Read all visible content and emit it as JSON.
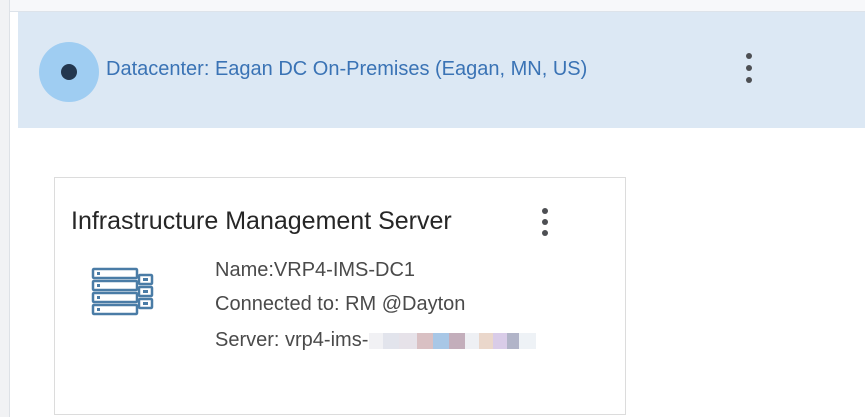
{
  "datacenter": {
    "title": "Datacenter: Eagan DC On-Premises (Eagan, MN, US)",
    "status_icon": "status-dot-icon",
    "menu_icon": "kebab-menu-icon",
    "colors": {
      "header_bg": "#dce8f4",
      "status_ring": "#9fcdf2",
      "status_dot": "#23374f",
      "title_text": "#3a73b5"
    }
  },
  "server_card": {
    "title": "Infrastructure Management Server",
    "icon": "server-rack-icon",
    "menu_icon": "kebab-menu-icon",
    "name_line": "Name:VRP4-IMS-DC1",
    "connected_line": "Connected to: RM @Dayton",
    "server_line": "Server: vrp4-ims-",
    "colors": {
      "icon": "#4a7ca6",
      "title_text": "#262626",
      "info_text": "#4a4a4a"
    }
  }
}
